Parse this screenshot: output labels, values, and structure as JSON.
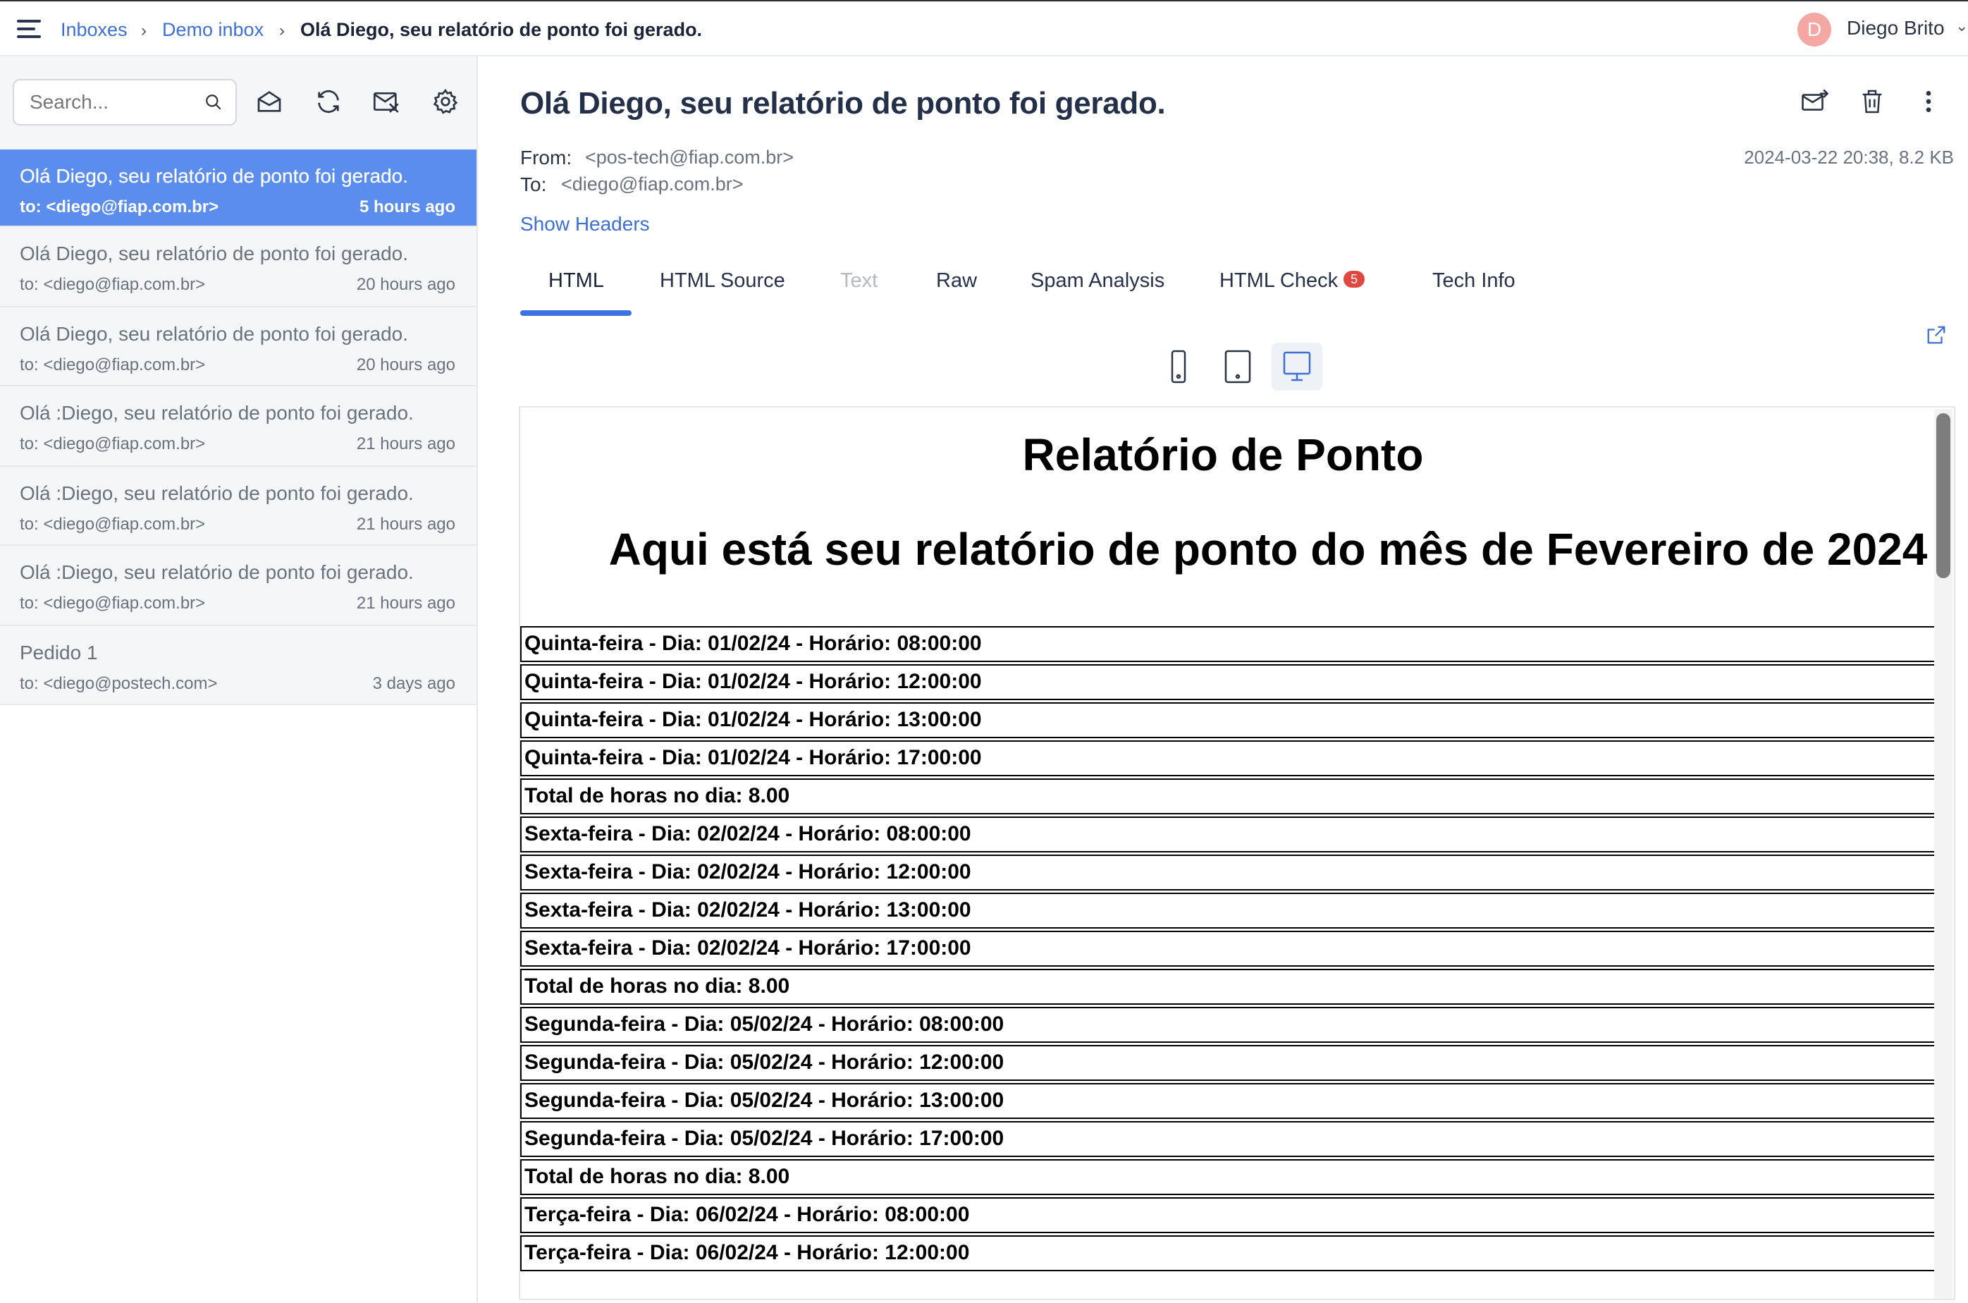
{
  "breadcrumb": {
    "inboxes": "Inboxes",
    "demo_inbox": "Demo inbox",
    "current": "Olá Diego, seu relatório de ponto foi gerado."
  },
  "user": {
    "initial": "D",
    "name": "Diego Brito"
  },
  "search": {
    "placeholder": "Search..."
  },
  "mails": [
    {
      "subject": "Olá Diego, seu relatório de ponto foi gerado.",
      "to": "to: <diego@fiap.com.br>",
      "ago": "5 hours ago",
      "active": true
    },
    {
      "subject": "Olá Diego, seu relatório de ponto foi gerado.",
      "to": "to: <diego@fiap.com.br>",
      "ago": "20 hours ago"
    },
    {
      "subject": "Olá Diego, seu relatório de ponto foi gerado.",
      "to": "to: <diego@fiap.com.br>",
      "ago": "20 hours ago"
    },
    {
      "subject": "Olá :Diego, seu relatório de ponto foi gerado.",
      "to": "to: <diego@fiap.com.br>",
      "ago": "21 hours ago"
    },
    {
      "subject": "Olá :Diego, seu relatório de ponto foi gerado.",
      "to": "to: <diego@fiap.com.br>",
      "ago": "21 hours ago"
    },
    {
      "subject": "Olá :Diego, seu relatório de ponto foi gerado.",
      "to": "to: <diego@fiap.com.br>",
      "ago": "21 hours ago"
    },
    {
      "subject": "Pedido 1",
      "to": "to: <diego@postech.com>",
      "ago": "3 days ago"
    }
  ],
  "message": {
    "title": "Olá Diego, seu relatório de ponto foi gerado.",
    "from_label": "From:",
    "from": "<pos-tech@fiap.com.br>",
    "to_label": "To:",
    "to": "<diego@fiap.com.br>",
    "meta": "2024-03-22 20:38, 8.2 KB",
    "show_headers": "Show Headers"
  },
  "tabs": {
    "html": "HTML",
    "html_source": "HTML Source",
    "text": "Text",
    "raw": "Raw",
    "spam": "Spam Analysis",
    "html_check": "HTML Check",
    "html_check_badge": "5",
    "tech_info": "Tech Info"
  },
  "email_body": {
    "heading": "Relatório de Ponto",
    "subheading": "Aqui está seu relatório de ponto do mês de Fevereiro de 2024",
    "rows": [
      "Quinta-feira - Dia: 01/02/24 - Horário: 08:00:00",
      "Quinta-feira - Dia: 01/02/24 - Horário: 12:00:00",
      "Quinta-feira - Dia: 01/02/24 - Horário: 13:00:00",
      "Quinta-feira - Dia: 01/02/24 - Horário: 17:00:00",
      "Total de horas no dia: 8.00",
      "Sexta-feira - Dia: 02/02/24 - Horário: 08:00:00",
      "Sexta-feira - Dia: 02/02/24 - Horário: 12:00:00",
      "Sexta-feira - Dia: 02/02/24 - Horário: 13:00:00",
      "Sexta-feira - Dia: 02/02/24 - Horário: 17:00:00",
      "Total de horas no dia: 8.00",
      "Segunda-feira - Dia: 05/02/24 - Horário: 08:00:00",
      "Segunda-feira - Dia: 05/02/24 - Horário: 12:00:00",
      "Segunda-feira - Dia: 05/02/24 - Horário: 13:00:00",
      "Segunda-feira - Dia: 05/02/24 - Horário: 17:00:00",
      "Total de horas no dia: 8.00",
      "Terça-feira - Dia: 06/02/24 - Horário: 08:00:00",
      "Terça-feira - Dia: 06/02/24 - Horário: 12:00:00"
    ]
  },
  "colors": {
    "accent": "#3e6fd6",
    "active_item": "#5b8def",
    "badge": "#e0473f"
  }
}
